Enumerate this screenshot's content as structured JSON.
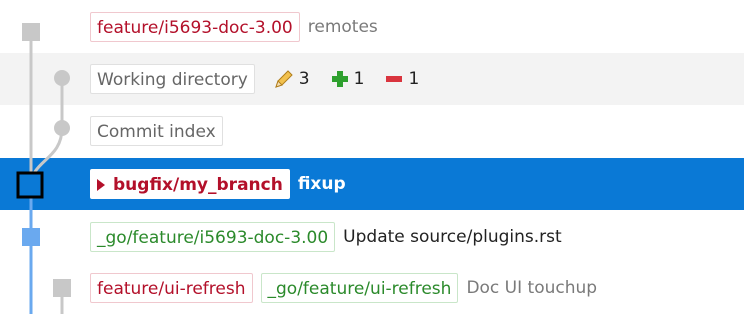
{
  "rows": [
    {
      "tags": [
        {
          "text": "feature/i5693-doc-3.00",
          "style": "red"
        }
      ],
      "message": "remotes"
    },
    {
      "tags": [
        {
          "text": "Working directory",
          "style": "grey"
        }
      ],
      "stats": {
        "modified": "3",
        "added": "1",
        "removed": "1"
      }
    },
    {
      "tags": [
        {
          "text": "Commit index",
          "style": "grey"
        }
      ]
    },
    {
      "tags": [
        {
          "text": "bugfix/my_branch",
          "style": "head"
        }
      ],
      "message": "fixup"
    },
    {
      "tags": [
        {
          "text": "_go/feature/i5693-doc-3.00",
          "style": "green"
        }
      ],
      "message": "Update source/plugins.rst"
    },
    {
      "tags": [
        {
          "text": "feature/ui-refresh",
          "style": "red"
        },
        {
          "text": "_go/feature/ui-refresh",
          "style": "green"
        }
      ],
      "message": "Doc UI touchup"
    }
  ],
  "icons": {
    "modified": "pencil-icon",
    "added": "plus-icon",
    "removed": "minus-icon"
  },
  "colors": {
    "selection": "#0a79d6",
    "branch_line_blue": "#6aa9ef",
    "graph_grey": "#c8c8c8",
    "local_branch": "#b3102a",
    "remote_branch": "#2b8a2b",
    "added": "#2ea02e",
    "removed": "#d9343e"
  }
}
